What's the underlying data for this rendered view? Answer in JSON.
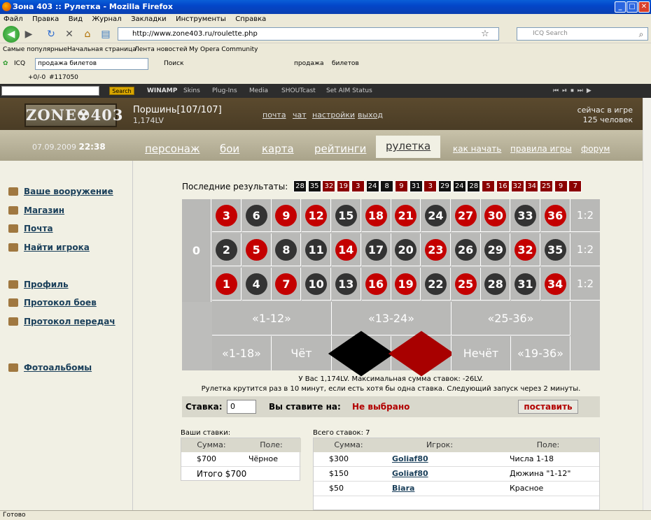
{
  "window": {
    "title": "Зона 403 :: Рулетка - Mozilla Firefox"
  },
  "menu": [
    "Файл",
    "Правка",
    "Вид",
    "Журнал",
    "Закладки",
    "Инструменты",
    "Справка"
  ],
  "nav": {
    "url": "http://www.zone403.ru/roulette.php",
    "search_placeholder": "ICQ Search"
  },
  "bookmarks": [
    "Самые популярные",
    "Начальная страница",
    "Лента новостей",
    "My Opera Community"
  ],
  "icqbar": {
    "label": "ICQ",
    "select_value": "продажа билетов",
    "search": "Поиск",
    "item1": "продажа",
    "item2": "билетов"
  },
  "bar3": {
    "count": "+0/-0",
    "id": "#117050"
  },
  "winamp": {
    "search_btn": "Search",
    "brand": "WINAMP",
    "items": [
      "Skins",
      "Plug-Ins",
      "Media",
      "SHOUTcast",
      "Set AIM Status"
    ]
  },
  "site": {
    "logo": "ZONE☢403",
    "user": "Поршинь[107/107]",
    "lv": "1,174LV",
    "toplinks": [
      "почта",
      "чат",
      "настройки",
      "выход"
    ],
    "online_line1": "сейчас в игре",
    "online_line2": "125 человек",
    "date": "07.09.2009",
    "time": "22:38",
    "tabs": [
      "персонаж",
      "бои",
      "карта",
      "рейтинги",
      "рулетка"
    ],
    "small_tabs": [
      "как начать",
      "правила игры",
      "форум"
    ]
  },
  "leftnav": [
    "Ваше вооружение",
    "Магазин",
    "Почта",
    "Найти игрока",
    "Профиль",
    "Протокол боев",
    "Протокол передач",
    "Фотоальбомы"
  ],
  "roulette": {
    "last_label": "Последние результаты:",
    "last": [
      {
        "n": "28",
        "c": "#111"
      },
      {
        "n": "35",
        "c": "#111"
      },
      {
        "n": "32",
        "c": "#8b0000"
      },
      {
        "n": "19",
        "c": "#8b0000"
      },
      {
        "n": "3",
        "c": "#8b0000"
      },
      {
        "n": "24",
        "c": "#111"
      },
      {
        "n": "8",
        "c": "#111"
      },
      {
        "n": "9",
        "c": "#8b0000"
      },
      {
        "n": "31",
        "c": "#111"
      },
      {
        "n": "3",
        "c": "#8b0000"
      },
      {
        "n": "29",
        "c": "#111"
      },
      {
        "n": "24",
        "c": "#111"
      },
      {
        "n": "28",
        "c": "#111"
      },
      {
        "n": "5",
        "c": "#8b0000"
      },
      {
        "n": "16",
        "c": "#8b0000"
      },
      {
        "n": "32",
        "c": "#8b0000"
      },
      {
        "n": "34",
        "c": "#8b0000"
      },
      {
        "n": "25",
        "c": "#8b0000"
      },
      {
        "n": "9",
        "c": "#8b0000"
      },
      {
        "n": "7",
        "c": "#8b0000"
      }
    ],
    "zero": "0",
    "rows": [
      [
        {
          "n": "3",
          "c": "r"
        },
        {
          "n": "6",
          "c": "b"
        },
        {
          "n": "9",
          "c": "r"
        },
        {
          "n": "12",
          "c": "r"
        },
        {
          "n": "15",
          "c": "b"
        },
        {
          "n": "18",
          "c": "r"
        },
        {
          "n": "21",
          "c": "r"
        },
        {
          "n": "24",
          "c": "b"
        },
        {
          "n": "27",
          "c": "r"
        },
        {
          "n": "30",
          "c": "r"
        },
        {
          "n": "33",
          "c": "b"
        },
        {
          "n": "36",
          "c": "r"
        }
      ],
      [
        {
          "n": "2",
          "c": "b"
        },
        {
          "n": "5",
          "c": "r"
        },
        {
          "n": "8",
          "c": "b"
        },
        {
          "n": "11",
          "c": "b"
        },
        {
          "n": "14",
          "c": "r"
        },
        {
          "n": "17",
          "c": "b"
        },
        {
          "n": "20",
          "c": "b"
        },
        {
          "n": "23",
          "c": "r"
        },
        {
          "n": "26",
          "c": "b"
        },
        {
          "n": "29",
          "c": "b"
        },
        {
          "n": "32",
          "c": "r"
        },
        {
          "n": "35",
          "c": "b"
        }
      ],
      [
        {
          "n": "1",
          "c": "r"
        },
        {
          "n": "4",
          "c": "b"
        },
        {
          "n": "7",
          "c": "r"
        },
        {
          "n": "10",
          "c": "b"
        },
        {
          "n": "13",
          "c": "b"
        },
        {
          "n": "16",
          "c": "r"
        },
        {
          "n": "19",
          "c": "r"
        },
        {
          "n": "22",
          "c": "b"
        },
        {
          "n": "25",
          "c": "r"
        },
        {
          "n": "28",
          "c": "b"
        },
        {
          "n": "31",
          "c": "b"
        },
        {
          "n": "34",
          "c": "r"
        }
      ]
    ],
    "two_to_one": "1:2",
    "dozens": [
      "«1-12»",
      "«13-24»",
      "«25-36»"
    ],
    "outside": [
      "«1-18»",
      "Чёт",
      "",
      "",
      "Нечёт",
      "«19-36»"
    ],
    "info1": "У Вас 1,174LV. Максимальная сумма ставок: -26LV.",
    "info2": "Рулетка крутится раз в 10 минут, если есть хотя бы одна ставка. Следующий запуск через 2 минуты.",
    "bet_label": "Ставка:",
    "bet_value": "0",
    "bet_on_label": "Вы ставите на:",
    "bet_on_value": "Не выбрано",
    "bet_button": "поставить"
  },
  "your_bets": {
    "label": "Ваши ставки:",
    "headers": [
      "Сумма:",
      "Поле:"
    ],
    "rows": [
      {
        "sum": "$700",
        "field": "Чёрное"
      }
    ],
    "total": "Итого $700"
  },
  "all_bets": {
    "label": "Всего ставок: 7",
    "headers": [
      "Сумма:",
      "Игрок:",
      "Поле:"
    ],
    "rows": [
      {
        "sum": "$300",
        "player": "Goliaf80",
        "field": "Числа 1-18"
      },
      {
        "sum": "$150",
        "player": "Goliaf80",
        "field": "Дюжина \"1-12\""
      },
      {
        "sum": "$50",
        "player": "Biara",
        "field": "Красное"
      }
    ]
  },
  "status": "Готово"
}
